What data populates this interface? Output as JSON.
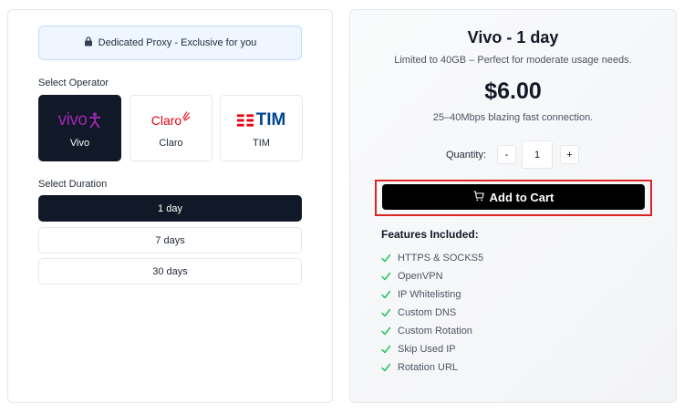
{
  "left": {
    "banner": {
      "text": "Dedicated Proxy - Exclusive for you",
      "icon": "lock-icon"
    },
    "operator_label": "Select Operator",
    "operators": [
      {
        "name": "Vivo",
        "logo_text": "vivo",
        "selected": true,
        "logo_color": "#8e24aa"
      },
      {
        "name": "Claro",
        "logo_text": "Claro",
        "selected": false,
        "logo_color": "#e30613"
      },
      {
        "name": "TIM",
        "logo_text": "TIM",
        "selected": false,
        "logo_color": "#004691",
        "logo_accent": "#e30613"
      }
    ],
    "duration_label": "Select Duration",
    "durations": [
      {
        "label": "1 day",
        "selected": true
      },
      {
        "label": "7 days",
        "selected": false
      },
      {
        "label": "30 days",
        "selected": false
      }
    ]
  },
  "right": {
    "title": "Vivo - 1 day",
    "description": "Limited to 40GB – Perfect for moderate usage needs.",
    "price": "$6.00",
    "speed": "25–40Mbps blazing fast connection.",
    "quantity_label": "Quantity:",
    "quantity_minus": "-",
    "quantity_value": "1",
    "quantity_plus": "+",
    "add_to_cart_label": "Add to Cart",
    "cart_icon": "cart-icon",
    "features_title": "Features Included:",
    "features": [
      "HTTPS & SOCKS5",
      "OpenVPN",
      "IP Whitelisting",
      "Custom DNS",
      "Custom Rotation",
      "Skip Used IP",
      "Rotation URL"
    ],
    "check_color": "#22c55e",
    "highlight_color": "#dc2626"
  }
}
